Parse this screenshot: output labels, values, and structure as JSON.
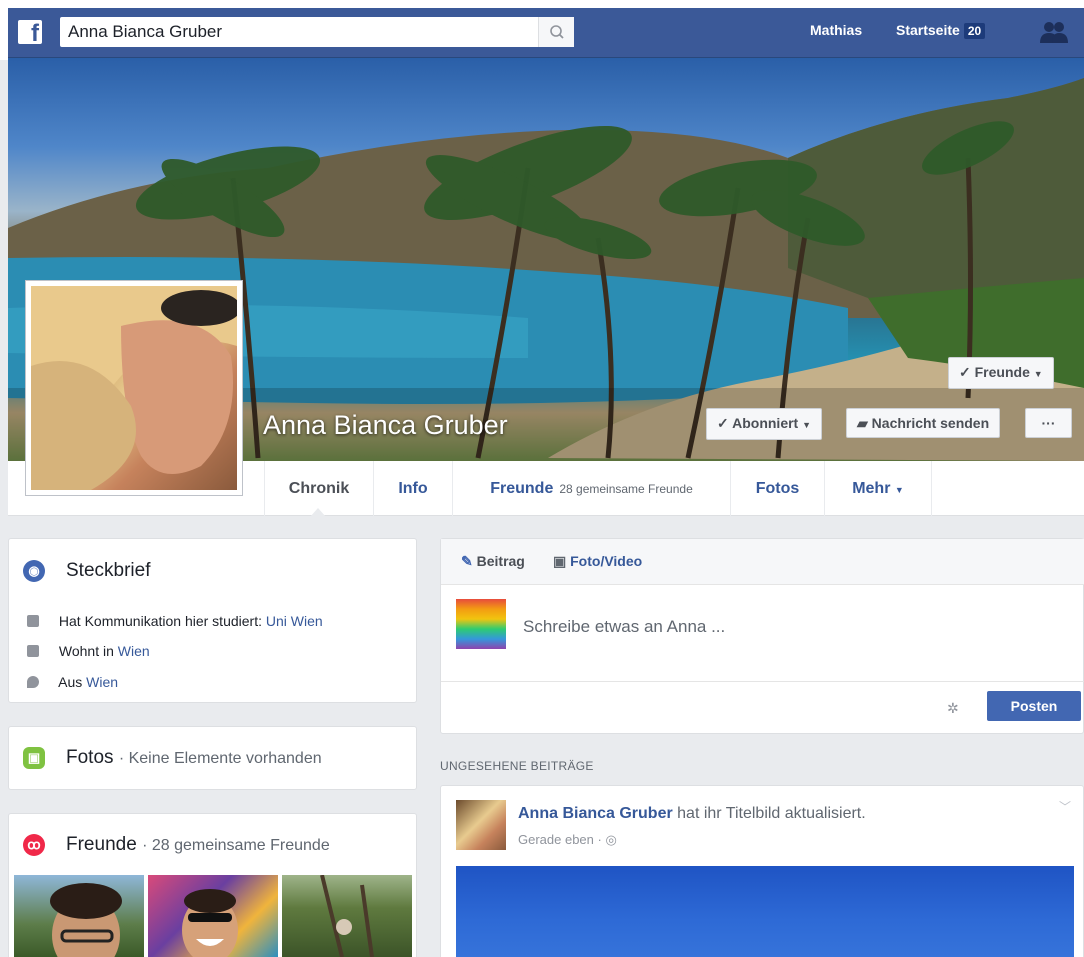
{
  "header": {
    "search_value": "Anna Bianca Gruber",
    "user_link": "Mathias",
    "home_link": "Startseite",
    "home_badge": "20"
  },
  "profile": {
    "name": "Anna Bianca Gruber",
    "buttons": {
      "friends": "Freunde",
      "subscribed": "Abonniert",
      "message": "Nachricht senden",
      "more": "···"
    }
  },
  "tabs": [
    {
      "label": "Chronik"
    },
    {
      "label": "Info"
    },
    {
      "label": "Freunde",
      "sub": "28 gemeinsame Freunde"
    },
    {
      "label": "Fotos"
    },
    {
      "label": "Mehr"
    }
  ],
  "intro": {
    "title": "Steckbrief",
    "rows": [
      {
        "text": "Hat Kommunikation hier studiert:",
        "link": "Uni Wien"
      },
      {
        "text": "Wohnt in",
        "link": "Wien"
      },
      {
        "text": "Aus",
        "link": "Wien"
      }
    ]
  },
  "photos": {
    "title": "Fotos",
    "sub": "· Keine Elemente vorhanden"
  },
  "friends": {
    "title": "Freunde",
    "sub": "· 28 gemeinsame Freunde"
  },
  "composer": {
    "tab_post": "Beitrag",
    "tab_photo": "Foto/Video",
    "placeholder": "Schreibe etwas an Anna ...",
    "post_button": "Posten"
  },
  "feed": {
    "section_label": "UNGESEHENE BEITRÄGE",
    "post": {
      "author": "Anna Bianca Gruber",
      "action": "hat ihr Titelbild aktualisiert.",
      "time": "Gerade eben ·"
    }
  },
  "colors": {
    "brand": "#3b5998",
    "link": "#365899",
    "button": "#4267b2"
  }
}
